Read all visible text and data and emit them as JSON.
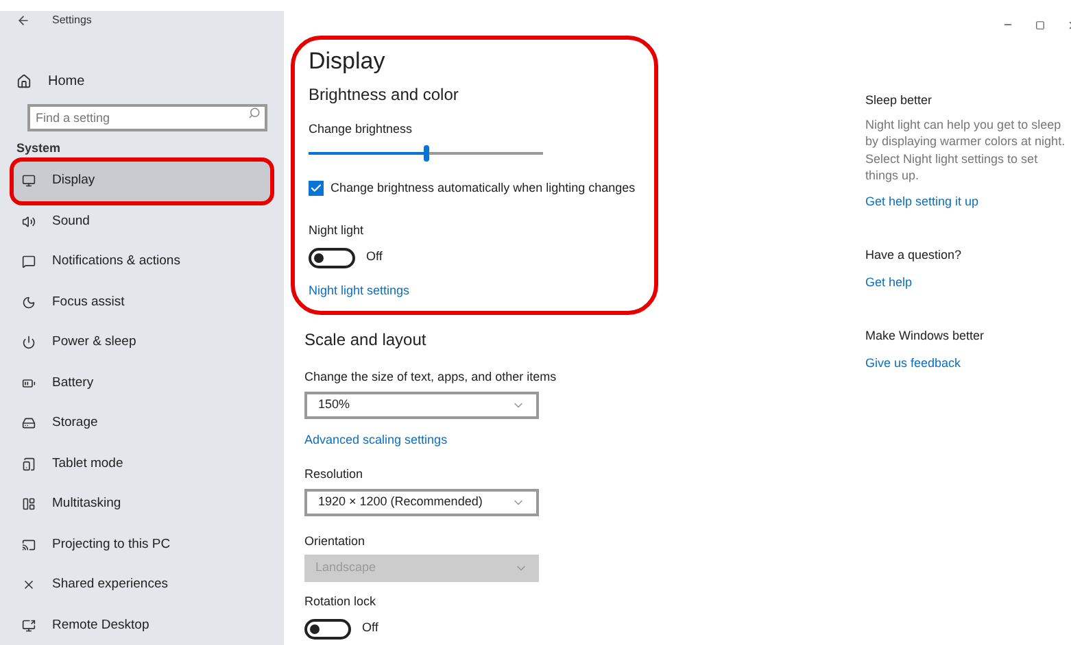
{
  "window": {
    "title": "Settings"
  },
  "sidebar": {
    "home": "Home",
    "search": {
      "placeholder": "Find a setting"
    },
    "section": "System",
    "items": [
      {
        "label": "Display",
        "selected": true,
        "highlighted": true
      },
      {
        "label": "Sound",
        "selected": false,
        "highlighted": false
      },
      {
        "label": "Notifications & actions",
        "selected": false,
        "highlighted": false
      },
      {
        "label": "Focus assist",
        "selected": false,
        "highlighted": false
      },
      {
        "label": "Power & sleep",
        "selected": false,
        "highlighted": false
      },
      {
        "label": "Battery",
        "selected": false,
        "highlighted": false
      },
      {
        "label": "Storage",
        "selected": false,
        "highlighted": false
      },
      {
        "label": "Tablet mode",
        "selected": false,
        "highlighted": false
      },
      {
        "label": "Multitasking",
        "selected": false,
        "highlighted": false
      },
      {
        "label": "Projecting to this PC",
        "selected": false,
        "highlighted": false
      },
      {
        "label": "Shared experiences",
        "selected": false,
        "highlighted": false
      },
      {
        "label": "Remote Desktop",
        "selected": false,
        "highlighted": false
      }
    ]
  },
  "main": {
    "title": "Display",
    "brightness_section": {
      "heading": "Brightness and color",
      "highlighted": true,
      "slider": {
        "label": "Change brightness",
        "level": 0.5
      },
      "checkbox": {
        "label": "Change brightness automatically when lighting changes",
        "checked": true
      },
      "night_light": {
        "label": "Night light",
        "on": false,
        "state": "Off"
      },
      "link": "Night light settings"
    },
    "scale_section": {
      "heading": "Scale and layout",
      "fields": [
        {
          "kind": "dropdown",
          "label": "Change the size of text, apps, and other items",
          "value": "150%",
          "disabled": false
        },
        {
          "kind": "link",
          "label": "Advanced scaling settings"
        },
        {
          "kind": "dropdown",
          "label": "Resolution",
          "value": "1920 × 1200 (Recommended)",
          "disabled": false
        },
        {
          "kind": "dropdown",
          "label": "Orientation",
          "value": "Landscape",
          "disabled": true
        },
        {
          "kind": "toggle",
          "label": "Rotation lock",
          "on": false,
          "state": "Off"
        }
      ]
    }
  },
  "aside": [
    {
      "heading": "Sleep better",
      "text": "Night light can help you get to sleep by displaying warmer colors at night. Select Night light settings to set things up.",
      "link": "Get help setting it up"
    },
    {
      "heading": "Have a question?",
      "link": "Get help"
    },
    {
      "heading": "Make Windows better",
      "link": "Give us feedback"
    }
  ]
}
